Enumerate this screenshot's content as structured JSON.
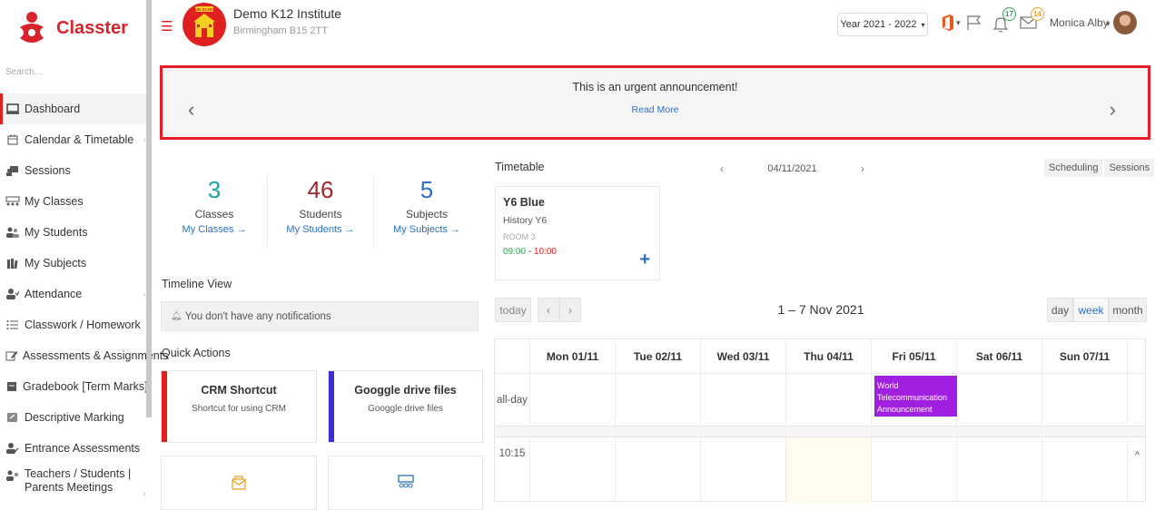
{
  "sidebar": {
    "brand": "Classter",
    "search_placeholder": "Search...",
    "items": [
      {
        "label": "Dashboard"
      },
      {
        "label": "Calendar & Timetable"
      },
      {
        "label": "Sessions"
      },
      {
        "label": "My Classes"
      },
      {
        "label": "My Students"
      },
      {
        "label": "My Subjects"
      },
      {
        "label": "Attendance"
      },
      {
        "label": "Classwork / Homework"
      },
      {
        "label": "Assessments & Assignments"
      },
      {
        "label": "Gradebook [Term Marks]"
      },
      {
        "label": "Descriptive Marking"
      },
      {
        "label": "Entrance Assessments"
      },
      {
        "label": "Teachers / Students | Parents Meetings"
      }
    ]
  },
  "header": {
    "school_logo_text": "YOUR SCHOOL",
    "institute_name": "Demo K12 Institute",
    "institute_address": "Birmingham B15 2TT",
    "year_select": "Year 2021 - 2022",
    "notifications_count": "17",
    "messages_count": "14",
    "user_name": "Monica Alby"
  },
  "announcement": {
    "title": "This is an urgent announcement!",
    "link": "Read More"
  },
  "stats": [
    {
      "value": "3",
      "label": "Classes",
      "link": "My Classes →"
    },
    {
      "value": "46",
      "label": "Students",
      "link": "My Students →"
    },
    {
      "value": "5",
      "label": "Subjects",
      "link": "My Subjects →"
    }
  ],
  "timeline": {
    "title": "Timeline View",
    "empty_text": "You don't have any notifications"
  },
  "quick_actions": {
    "title": "Quick Actions",
    "cards": [
      {
        "title": "CRM Shortcut",
        "subtitle": "Shortcut for using CRM",
        "color": "#e02020"
      },
      {
        "title": "Googgle drive files",
        "subtitle": "Googgle drive files",
        "color": "#3a2fd0"
      }
    ]
  },
  "timetable": {
    "title": "Timetable",
    "date": "04/11/2021",
    "tabs": [
      "Scheduling",
      "Sessions"
    ],
    "session": {
      "class": "Y6 Blue",
      "subject": "History Y6",
      "room": "ROOM 3",
      "start": "09:00",
      "end": "10:00"
    }
  },
  "calendar": {
    "today_label": "today",
    "range": "1 – 7 Nov 2021",
    "views": [
      "day",
      "week",
      "month"
    ],
    "active_view": "week",
    "days": [
      "Mon 01/11",
      "Tue 02/11",
      "Wed 03/11",
      "Thu 04/11",
      "Fri 05/11",
      "Sat 06/11",
      "Sun 07/11"
    ],
    "allday_label": "all-day",
    "time_label": "10:15",
    "event": {
      "title": "World Telecommunication Announcement",
      "day": "Fri 05/11",
      "color": "#a01fe0"
    }
  }
}
